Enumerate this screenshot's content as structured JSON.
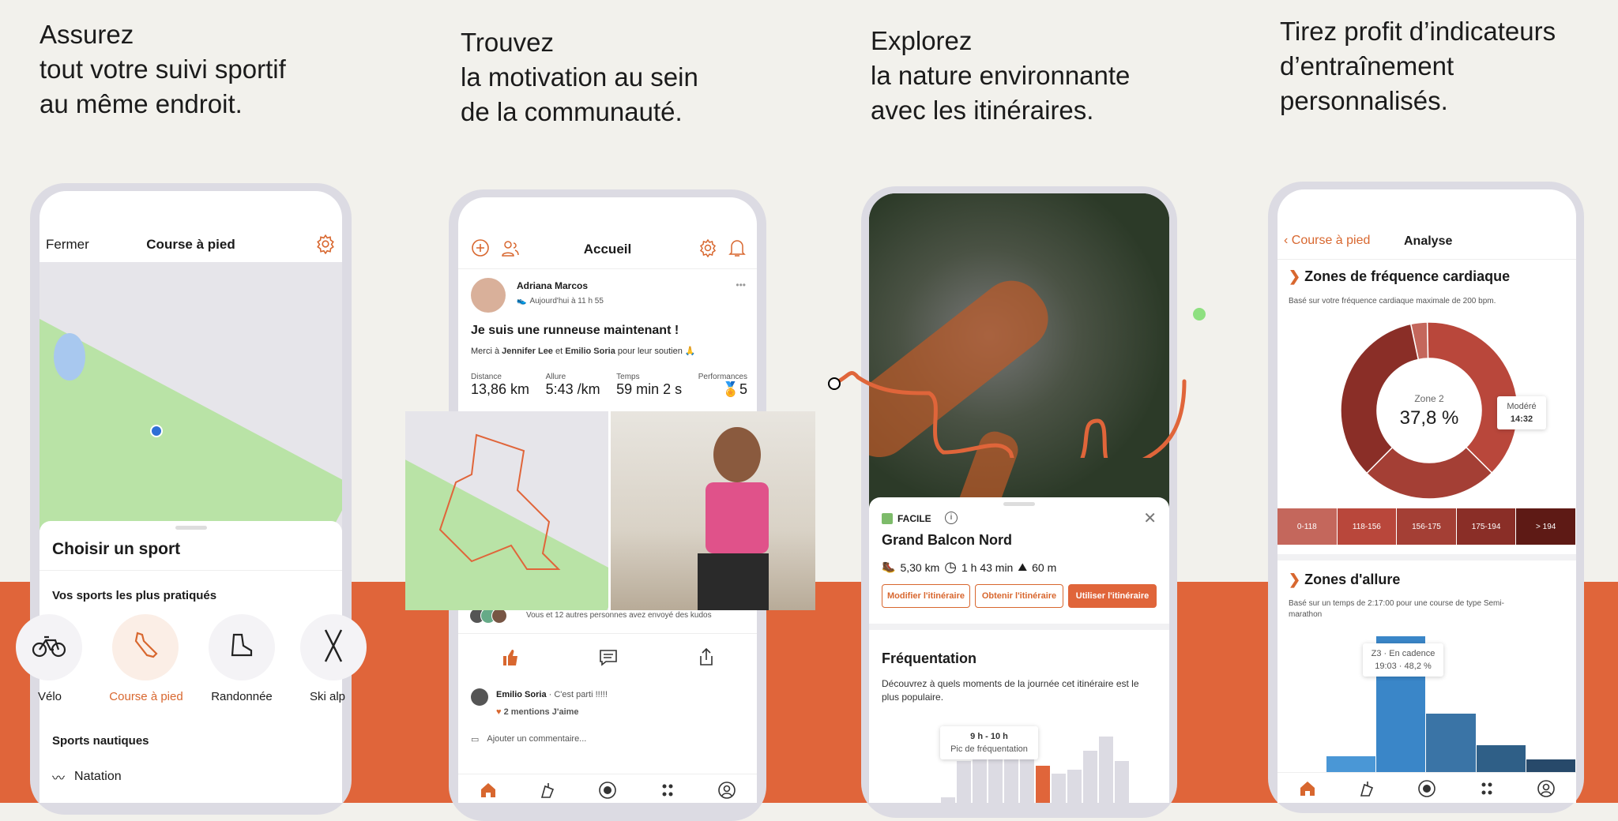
{
  "panels": [
    {
      "headline": "Assurez\ntout votre suivi sportif\nau même endroit."
    },
    {
      "headline": "Trouvez\nla motivation au sein\nde la communauté."
    },
    {
      "headline": "Explorez\nla nature environnante\navec les itinéraires."
    },
    {
      "headline": "Tirez profit d’indicateurs\nd’entraînement\npersonnalisés."
    }
  ],
  "colors": {
    "accent": "#d8672f",
    "band": "#e0653a",
    "background": "#f2f1ec",
    "park": "#b9e3a6",
    "easy": "#7dbb6a",
    "pace": "#3a7fb8"
  },
  "sport_picker": {
    "close": "Fermer",
    "title": "Course à pied",
    "settings_icon": "gear-icon",
    "sheet_title": "Choisir un sport",
    "section_top": "Vos sports les plus pratiqués",
    "sports": [
      {
        "label": "Vélo",
        "icon": "bike-icon"
      },
      {
        "label": "Course à pied",
        "icon": "running-shoe-icon",
        "selected": true
      },
      {
        "label": "Randonnée",
        "icon": "hiking-boot-icon"
      },
      {
        "label": "Ski alp",
        "icon": "ski-icon"
      }
    ],
    "section_water": "Sports nautiques",
    "water_item": "Natation"
  },
  "feed": {
    "title": "Accueil",
    "author": "Adriana Marcos",
    "time": "Aujourd'hui à 11 h 55",
    "post_title": "Je suis une runneuse maintenant !",
    "thanks_pre": "Merci à ",
    "thanks_a": "Jennifer Lee",
    "thanks_mid": " et ",
    "thanks_b": "Emilio Soria",
    "thanks_post": " pour leur soutien 🙏",
    "stats": [
      {
        "label": "Distance",
        "value": "13,86 km"
      },
      {
        "label": "Allure",
        "value": "5:43 /km"
      },
      {
        "label": "Temps",
        "value": "59 min 2 s"
      },
      {
        "label": "Performances",
        "value": "5"
      }
    ],
    "kudos": "Vous et 12 autres personnes avez envoyé des kudos",
    "comment_author": "Emilio Soria",
    "comment_text": "· C'est parti !!!!!",
    "likes": "2 mentions J'aime",
    "add_comment": "Ajouter un commentaire..."
  },
  "route": {
    "difficulty": "FACILE",
    "name": "Grand Balcon Nord",
    "distance": "5,30 km",
    "duration": "1 h 43 min",
    "elevation": "60 m",
    "buttons": [
      "Modifier l'itinéraire",
      "Obtenir l'itinéraire",
      "Utiliser l'itinéraire"
    ],
    "freq_title": "Fréquentation",
    "freq_desc": "Découvrez à quels moments de la journée cet itinéraire est le plus populaire.",
    "tip_title": "9 h - 10 h",
    "tip_sub": "Pic de fréquentation",
    "freq_levels": [
      8,
      45,
      70,
      78,
      78,
      68,
      40,
      32,
      36,
      55,
      70,
      45
    ],
    "freq_highlight": 6
  },
  "analysis": {
    "back": "Course à pied",
    "title": "Analyse",
    "hr_title": "Zones de fréquence cardiaque",
    "hr_desc": "Basé sur votre fréquence cardiaque maximale de 200 bpm.",
    "center_label": "Zone 2",
    "center_value": "37,8 %",
    "tip_label": "Modéré",
    "tip_value": "14:32",
    "zones": [
      {
        "label": "0-118",
        "color": "#c4675c",
        "pct": 3
      },
      {
        "label": "118-156",
        "color": "#b9473b",
        "pct": 37.8
      },
      {
        "label": "156-175",
        "color": "#a43f35",
        "pct": 25
      },
      {
        "label": "175-194",
        "color": "#8a2e27",
        "pct": 34.2
      },
      {
        "label": "> 194",
        "color": "#5e1a15",
        "pct": 0
      }
    ],
    "pace_title": "Zones d'allure",
    "pace_desc": "Basé sur un temps de 2:17:00 pour une course de type Semi-marathon",
    "pace_tip_a": "Z3 · En cadence",
    "pace_tip_b": "19:03  ·  48,2 %",
    "pace_values": [
      6,
      48.2,
      21,
      10,
      5
    ],
    "pace_colors": [
      "#4a97d6",
      "#3a86c8",
      "#3a74a6",
      "#2f5f87",
      "#27496a"
    ]
  },
  "nav_icons": [
    "home-icon",
    "routes-icon",
    "record-icon",
    "groups-icon",
    "profile-icon"
  ]
}
